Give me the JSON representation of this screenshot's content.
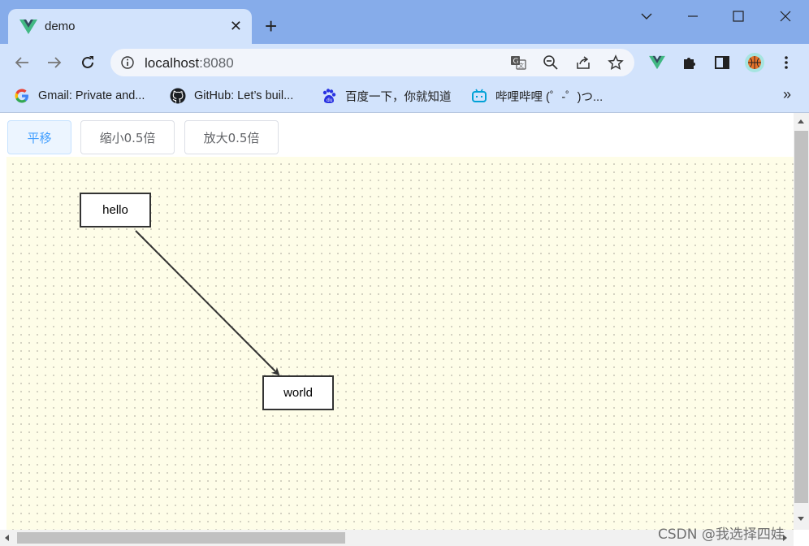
{
  "browser": {
    "tab": {
      "title": "demo",
      "close_glyph": "✕"
    },
    "new_tab_glyph": "+",
    "window_controls": {
      "dropdown_glyph": "⌵",
      "minimize_glyph": "—",
      "maximize_glyph": "☐",
      "close_glyph": "✕"
    },
    "address_bar": {
      "host": "localhost",
      "port": ":8080"
    },
    "bookmarks": [
      {
        "label": "Gmail: Private and...",
        "icon": "google-icon"
      },
      {
        "label": "GitHub: Let’s buil...",
        "icon": "github-icon"
      },
      {
        "label": "百度一下，你就知道",
        "icon": "baidu-icon"
      },
      {
        "label": "哔哩哔哩 (゜-゜)つ...",
        "icon": "bilibili-icon"
      }
    ],
    "bookmarks_overflow": "»"
  },
  "toolbar_buttons": [
    {
      "label": "平移",
      "active": true
    },
    {
      "label": "缩小0.5倍",
      "active": false
    },
    {
      "label": "放大0.5倍",
      "active": false
    }
  ],
  "diagram": {
    "nodes": [
      {
        "id": "n1",
        "text": "hello"
      },
      {
        "id": "n2",
        "text": "world"
      }
    ],
    "edges": [
      {
        "from": "n1",
        "to": "n2"
      }
    ]
  },
  "watermark": "CSDN @我选择四娃",
  "colors": {
    "canvas_bg": "#fefde8",
    "tab_strip": "#86acea",
    "toolbar": "#d2e3fc",
    "active_button": "#409eff"
  }
}
